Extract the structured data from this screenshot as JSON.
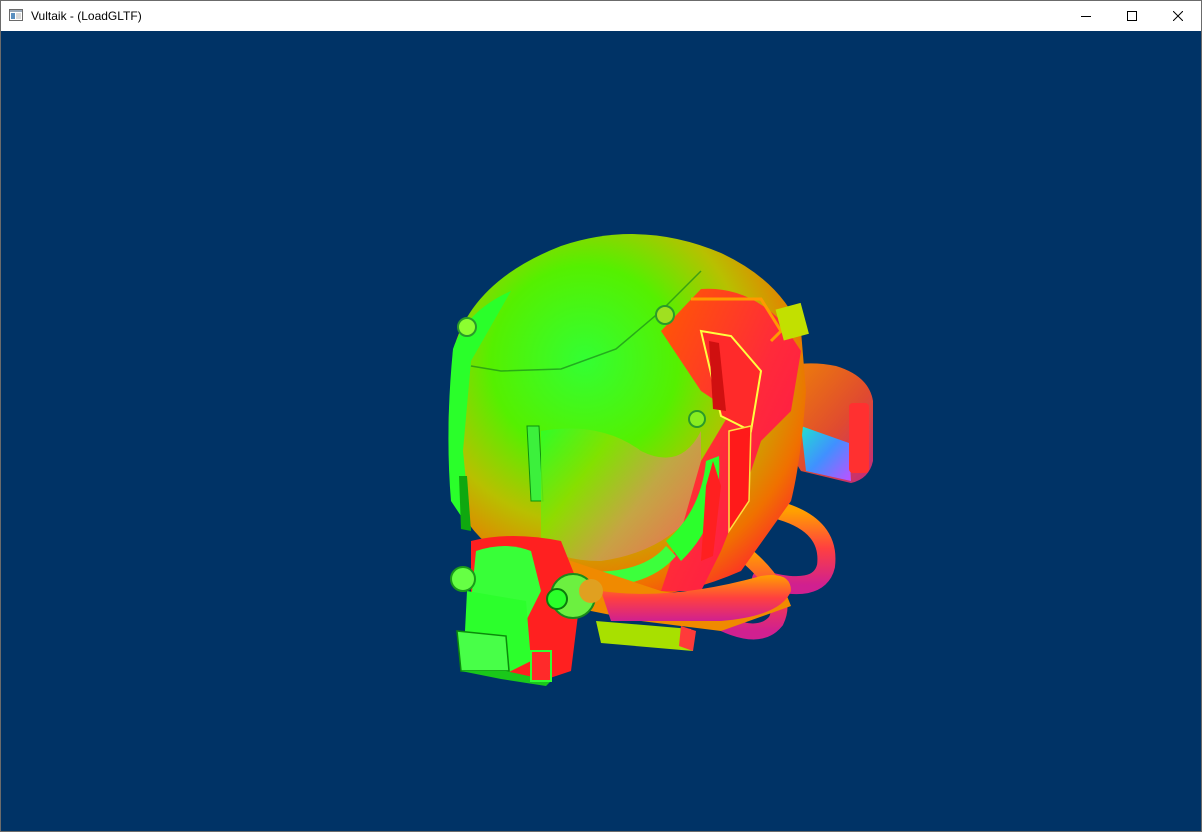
{
  "window": {
    "title": "Vultaik - (LoadGLTF)",
    "icon": "app-window-icon",
    "buttons": {
      "minimize": "minimize-icon",
      "maximize": "maximize-icon",
      "close": "close-icon"
    }
  },
  "viewport": {
    "background_color": "#003366",
    "model": "helmet",
    "shading": "normals"
  }
}
